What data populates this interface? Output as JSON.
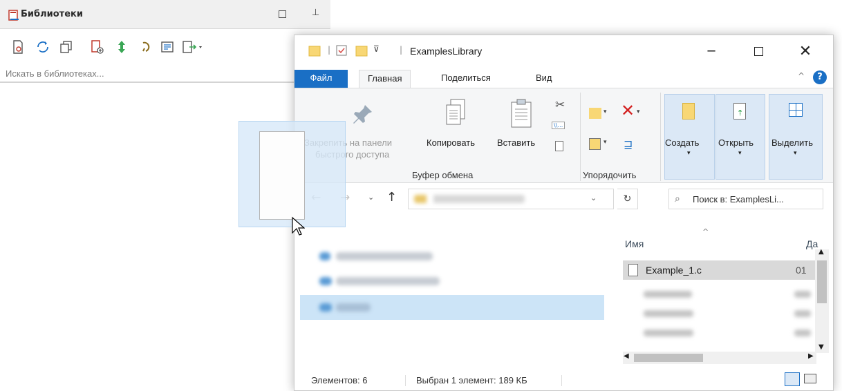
{
  "libraries_panel": {
    "title": "Библиотеки",
    "search_placeholder": "Искать в библиотеках...",
    "toolbar_icons": [
      "library-doc-icon",
      "refresh-icon",
      "copy-icon",
      "add-library-icon",
      "navigate-icon",
      "link-icon",
      "view-icon",
      "export-dropdown-icon"
    ]
  },
  "explorer": {
    "title": "ExamplesLibrary",
    "tabs": [
      "Файл",
      "Главная",
      "Поделиться",
      "Вид"
    ],
    "ribbon": {
      "pin_label_1": "Закрепить на панели",
      "pin_label_2": "быстрого доступа",
      "copy": "Копировать",
      "paste": "Вставить",
      "clipboard_group": "Буфер обмена",
      "organize_group": "Упорядочить",
      "create": "Создать",
      "open": "Открыть",
      "select": "Выделить"
    },
    "search_placeholder": "Поиск в: ExamplesLi...",
    "columns": {
      "name": "Имя",
      "date": "Да"
    },
    "selected_file": {
      "name": "Example_1.c",
      "date": "01"
    },
    "status": {
      "count": "Элементов: 6",
      "selection": "Выбран 1 элемент: 189 КБ"
    },
    "colors": {
      "accent": "#1a6fc5",
      "selected_row": "#d9d9d9",
      "nav_highlight": "#cce4f7"
    }
  }
}
